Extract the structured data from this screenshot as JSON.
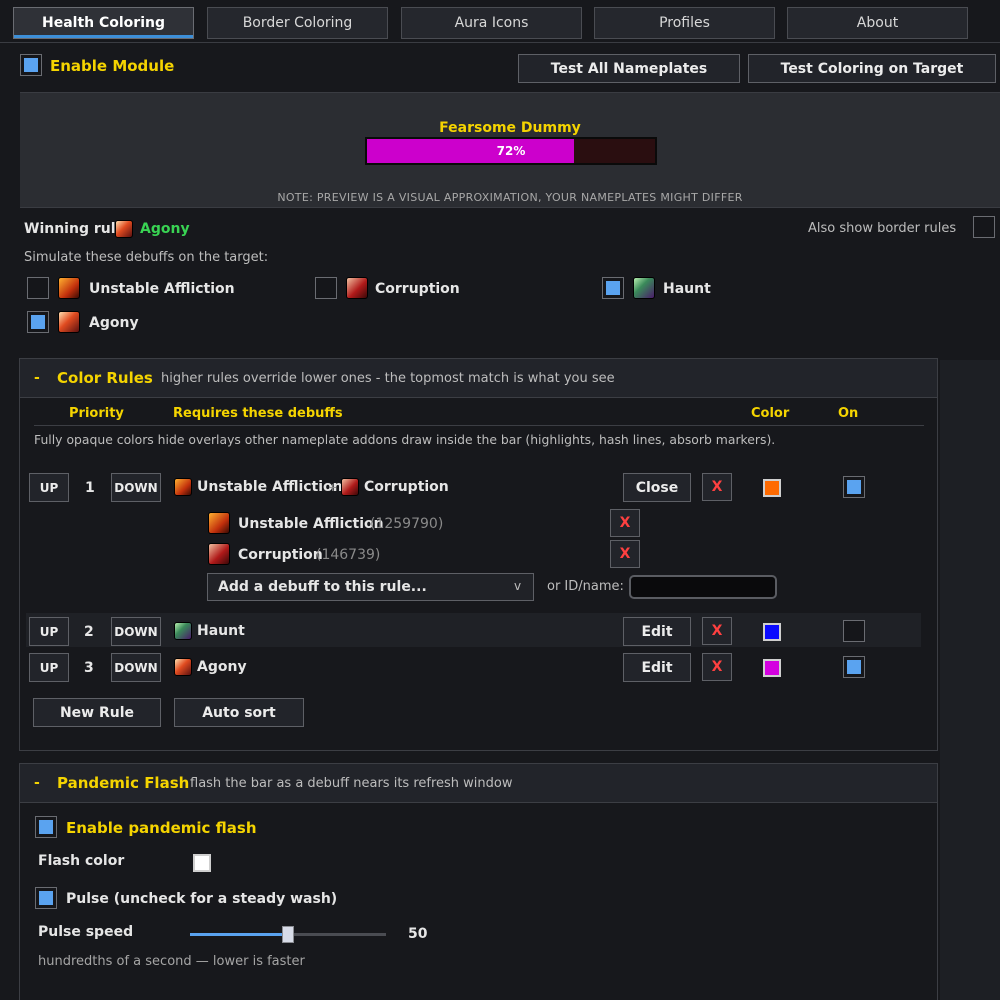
{
  "tabs": [
    "Health Coloring",
    "Border Coloring",
    "Aura Icons",
    "Profiles",
    "About"
  ],
  "enable_module": {
    "label": "Enable Module",
    "checked": true
  },
  "buttons": {
    "test_all": "Test All Nameplates",
    "test_target": "Test Coloring on Target"
  },
  "preview": {
    "unit_name": "Fearsome Dummy",
    "health_percent": 72,
    "health_label": "72%",
    "bar_color": "#cc00cc",
    "note": "NOTE: PREVIEW IS A VISUAL APPROXIMATION, YOUR NAMEPLATES MIGHT DIFFER"
  },
  "winning_rule": {
    "label": "Winning rule:",
    "value": "Agony"
  },
  "also_show_border": {
    "label": "Also show border rules",
    "checked": false
  },
  "simulate": {
    "label": "Simulate these debuffs on the target:",
    "items": [
      {
        "name": "Unstable Affliction",
        "checked": false,
        "icon": "unstable-affliction-icon"
      },
      {
        "name": "Corruption",
        "checked": false,
        "icon": "corruption-icon"
      },
      {
        "name": "Haunt",
        "checked": true,
        "icon": "haunt-icon"
      },
      {
        "name": "Agony",
        "checked": true,
        "icon": "agony-icon"
      }
    ]
  },
  "color_rules": {
    "collapse": "-",
    "title": "Color Rules",
    "subtitle": "higher rules override lower ones - the topmost match is what you see",
    "headers": {
      "priority": "Priority",
      "requires": "Requires these debuffs",
      "color": "Color",
      "on": "On"
    },
    "note": "Fully opaque colors hide overlays other nameplate addons draw inside the bar (highlights, hash lines, absorb markers).",
    "up": "UP",
    "down": "DOWN",
    "x": "X",
    "plus": "+",
    "rules": [
      {
        "priority": "1",
        "debuffs": [
          "Unstable Affliction",
          "Corruption"
        ],
        "action": "Close",
        "color": "#ff6a00",
        "on": true
      },
      {
        "priority": "2",
        "debuffs": [
          "Haunt"
        ],
        "action": "Edit",
        "color": "#0a0aff",
        "on": false
      },
      {
        "priority": "3",
        "debuffs": [
          "Agony"
        ],
        "action": "Edit",
        "color": "#d400e0",
        "on": true
      }
    ],
    "expanded": {
      "debuffs": [
        {
          "name": "Unstable Affliction",
          "id": "(1259790)"
        },
        {
          "name": "Corruption",
          "id": "(146739)"
        }
      ],
      "add_placeholder": "Add a debuff to this rule...",
      "dropdown_arrow": "v",
      "or_label": "or ID/name:",
      "input_value": ""
    },
    "new_rule": "New Rule",
    "auto_sort": "Auto sort"
  },
  "pandemic": {
    "collapse": "-",
    "title": "Pandemic Flash",
    "subtitle": "flash the bar as a debuff nears its refresh window",
    "enable": {
      "label": "Enable pandemic flash",
      "checked": true
    },
    "flash_color": {
      "label": "Flash color",
      "color": "#ffffff"
    },
    "pulse": {
      "label": "Pulse (uncheck for a steady wash)",
      "checked": true
    },
    "speed": {
      "label": "Pulse speed",
      "value": 50,
      "min": 0,
      "max": 100,
      "value_label": "50"
    },
    "hint": "hundredths of a second — lower is faster"
  },
  "colors": {
    "accent": "#5aa3f0",
    "yellow": "#f5d400",
    "green": "#39d353",
    "red": "#ff4040"
  }
}
